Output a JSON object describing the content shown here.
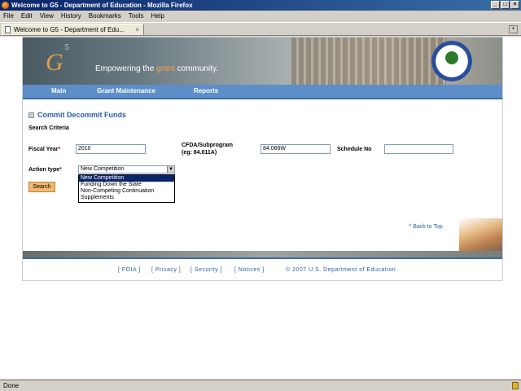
{
  "window": {
    "title": "Welcome to G5 - Department of Education - Mozilla Firefox"
  },
  "menu": [
    "File",
    "Edit",
    "View",
    "History",
    "Bookmarks",
    "Tools",
    "Help"
  ],
  "tabs": [
    {
      "label": "Welcome to G5 - Department of Edu..."
    }
  ],
  "banner": {
    "logo": "G",
    "logo_sup": "5",
    "slogan_pre": "Empowering the ",
    "slogan_mid": "grant",
    "slogan_post": " community."
  },
  "nav": [
    "Main",
    "Grant Maintenance",
    "Reports"
  ],
  "page": {
    "title": "Commit Decommit Funds",
    "section": "Search Criteria",
    "fiscal_year_label": "Fiscal Year",
    "fiscal_year_value": "2010",
    "cfda_label_1": "CFDA/Subprogram",
    "cfda_label_2": "(eg: 84.011A)",
    "cfda_value": "84.066W",
    "schedule_label": "Schedule No",
    "schedule_value": "",
    "action_type_label": "Action type",
    "action_type_selected": "New Competition",
    "action_type_options": [
      "New Competition",
      "Funding Down the Slate",
      "Non-Competing Continuation",
      "Supplements"
    ],
    "search_button": "Search",
    "back_to_top": "^ Back to Top"
  },
  "footer": [
    "[ FOIA ]",
    "[ Privacy ]",
    "[ Security ]",
    "[ Notices ]",
    "© 2007 U.S. Department of Education"
  ],
  "status": {
    "text": "Done"
  }
}
